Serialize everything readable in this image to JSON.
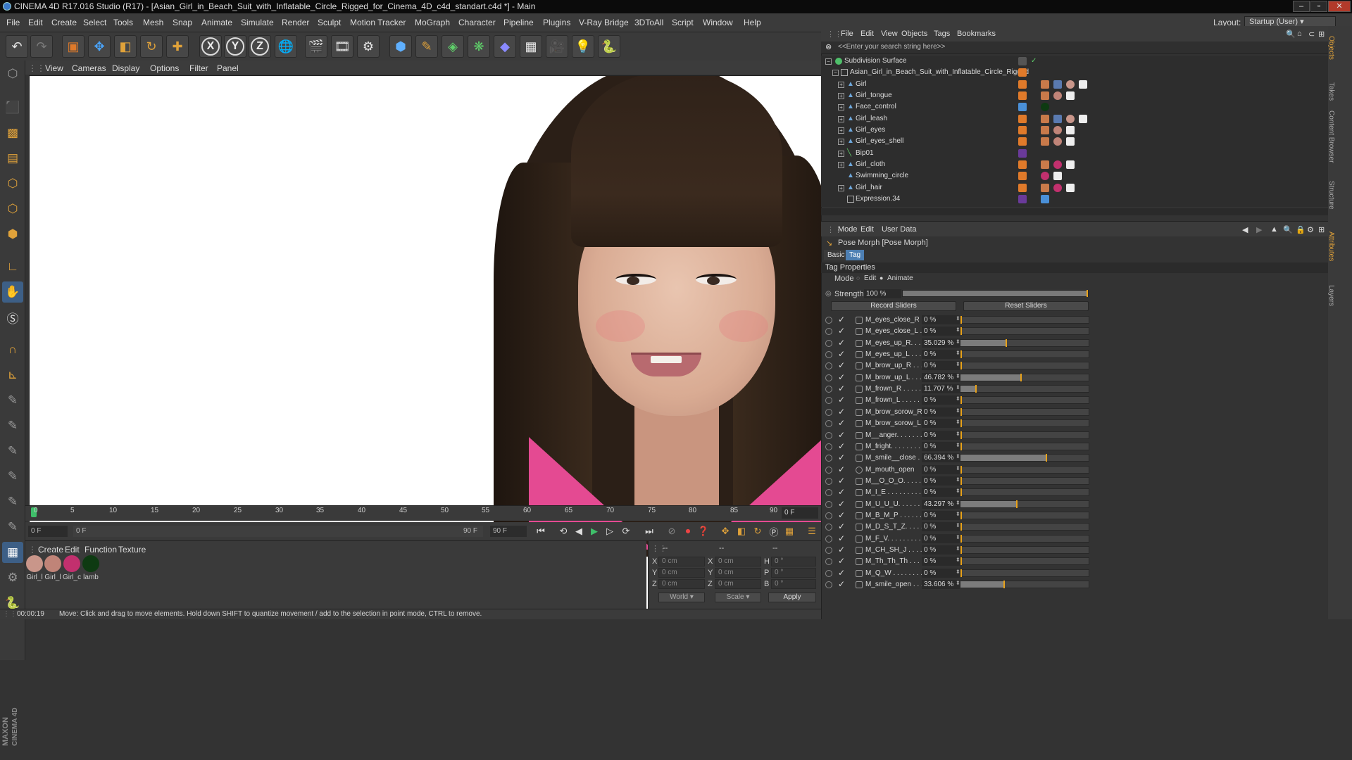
{
  "window": {
    "title": "CINEMA 4D R17.016 Studio (R17) - [Asian_Girl_in_Beach_Suit_with_Inflatable_Circle_Rigged_for_Cinema_4D_c4d_standart.c4d *] - Main"
  },
  "menubar": {
    "items": [
      "File",
      "Edit",
      "Create",
      "Select",
      "Tools",
      "Mesh",
      "Snap",
      "Animate",
      "Simulate",
      "Render",
      "Sculpt",
      "Motion Tracker",
      "MoGraph",
      "Character",
      "Pipeline",
      "Plugins",
      "V-Ray Bridge",
      "3DToAll",
      "Script",
      "Window",
      "Help"
    ],
    "layout_label": "Layout:",
    "layout_value": "Startup (User)"
  },
  "toolbar": {
    "axis_x": "X",
    "axis_y": "Y",
    "axis_z": "Z"
  },
  "viewport": {
    "menu": [
      "View",
      "Cameras",
      "Display",
      "Options",
      "Filter",
      "Panel"
    ]
  },
  "timeline": {
    "ticks": [
      "0",
      "5",
      "10",
      "15",
      "20",
      "25",
      "30",
      "35",
      "40",
      "45",
      "50",
      "55",
      "60",
      "65",
      "70",
      "75",
      "80",
      "85",
      "90"
    ],
    "current_frame": "0 F",
    "start_field": "0 F",
    "range_start": "0 F",
    "range_end": "90 F",
    "end_field": "90 F"
  },
  "materials": {
    "menu": [
      "Create",
      "Edit",
      "Function",
      "Texture"
    ],
    "items": [
      {
        "label": "Girl_l",
        "color": "#c9968a"
      },
      {
        "label": "Girl_l",
        "color": "#c08478"
      },
      {
        "label": "Girl_c",
        "color": "#c2306e"
      },
      {
        "label": "lamb",
        "color": "#0e3a12"
      }
    ]
  },
  "coords": {
    "header": [
      "--",
      "--",
      "--"
    ],
    "rows": [
      {
        "a": "X",
        "av": "0 cm",
        "b": "X",
        "bv": "0 cm",
        "c": "H",
        "cv": "0 °"
      },
      {
        "a": "Y",
        "av": "0 cm",
        "b": "Y",
        "bv": "0 cm",
        "c": "P",
        "cv": "0 °"
      },
      {
        "a": "Z",
        "av": "0 cm",
        "b": "Z",
        "bv": "0 cm",
        "c": "B",
        "cv": "0 °"
      }
    ],
    "space": "World",
    "mode": "Scale",
    "apply": "Apply"
  },
  "status": {
    "time": "00:00:19",
    "message": "Move: Click and drag to move elements. Hold down SHIFT to quantize movement / add to the selection in point mode, CTRL to remove."
  },
  "objects_panel": {
    "menu": [
      "File",
      "Edit",
      "View",
      "Objects",
      "Tags",
      "Bookmarks"
    ],
    "search_placeholder": "<<Enter your search string here>>",
    "tree": [
      {
        "name": "Subdivision Surface",
        "level": 0,
        "layer": ""
      },
      {
        "name": "Asian_Girl_in_Beach_Suit_with_Inflatable_Circle_Rigged",
        "level": 1,
        "layer": "#e07a2a"
      },
      {
        "name": "Girl",
        "level": 2,
        "layer": "#e07a2a"
      },
      {
        "name": "Girl_tongue",
        "level": 2,
        "layer": "#e07a2a"
      },
      {
        "name": "Face_control",
        "level": 2,
        "layer": "#4a90d8"
      },
      {
        "name": "Girl_leash",
        "level": 2,
        "layer": "#e07a2a"
      },
      {
        "name": "Girl_eyes",
        "level": 2,
        "layer": "#e07a2a"
      },
      {
        "name": "Girl_eyes_shell",
        "level": 2,
        "layer": "#e07a2a"
      },
      {
        "name": "Bip01",
        "level": 2,
        "layer": "#6a3a9a"
      },
      {
        "name": "Girl_cloth",
        "level": 2,
        "layer": "#e07a2a"
      },
      {
        "name": "Swimming_circle",
        "level": 2,
        "layer": "#e07a2a"
      },
      {
        "name": "Girl_hair",
        "level": 2,
        "layer": "#e07a2a"
      },
      {
        "name": "Expression.34",
        "level": 2,
        "layer": "#6a3a9a"
      }
    ]
  },
  "side_tabs": [
    "Objects",
    "Takes",
    "Content Browser",
    "Structure",
    "Attributes",
    "Layers"
  ],
  "attributes": {
    "menu": [
      "Mode",
      "Edit",
      "User Data"
    ],
    "title": "Pose Morph [Pose Morph]",
    "tabs": [
      "Basic",
      "Tag"
    ],
    "section": "Tag Properties",
    "mode_label": "Mode",
    "mode_options": [
      "Edit",
      "Animate"
    ],
    "strength_label": "Strength",
    "strength_value": "100 %",
    "strength": 1.0,
    "record_button": "Record Sliders",
    "reset_button": "Reset Sliders",
    "morphs": [
      {
        "name": "M_eyes_close_R . .",
        "value": "0 %",
        "pct": 0
      },
      {
        "name": "M_eyes_close_L . .",
        "value": "0 %",
        "pct": 0
      },
      {
        "name": "M_eyes_up_R. . . .",
        "value": "35.029 %",
        "pct": 35.029
      },
      {
        "name": "M_eyes_up_L . . . .",
        "value": "0 %",
        "pct": 0
      },
      {
        "name": "M_brow_up_R . . .",
        "value": "0 %",
        "pct": 0
      },
      {
        "name": "M_brow_up_L . . .",
        "value": "46.782 %",
        "pct": 46.782
      },
      {
        "name": "M_frown_R . . . . .",
        "value": "11.707 %",
        "pct": 11.707
      },
      {
        "name": "M_frown_L . . . . .",
        "value": "0 %",
        "pct": 0
      },
      {
        "name": "M_brow_sorow_R",
        "value": "0 %",
        "pct": 0
      },
      {
        "name": "M_brow_sorow_L",
        "value": "0 %",
        "pct": 0
      },
      {
        "name": "M__anger. . . . . . .",
        "value": "0 %",
        "pct": 0
      },
      {
        "name": "M_fright. . . . . . . .",
        "value": "0 %",
        "pct": 0
      },
      {
        "name": "M_smile__close . .",
        "value": "66.394 %",
        "pct": 66.394
      },
      {
        "name": "M_mouth_open",
        "value": "0 %",
        "pct": 0
      },
      {
        "name": "M__O_O_O. . . . . .",
        "value": "0 %",
        "pct": 0
      },
      {
        "name": "M_I_E . . . . . . . . .",
        "value": "0 %",
        "pct": 0
      },
      {
        "name": "M_U_U_U. . . . . . .",
        "value": "43.297 %",
        "pct": 43.297
      },
      {
        "name": "M_B_M_P . . . . . .",
        "value": "0 %",
        "pct": 0
      },
      {
        "name": "M_D_S_T_Z. . . . .",
        "value": "0 %",
        "pct": 0
      },
      {
        "name": "M_F_V. . . . . . . . .",
        "value": "0 %",
        "pct": 0
      },
      {
        "name": "M_CH_SH_J . . . .",
        "value": "0 %",
        "pct": 0
      },
      {
        "name": "M_Th_Th_Th . . . .",
        "value": "0 %",
        "pct": 0
      },
      {
        "name": "M_Q_W . . . . . . . .",
        "value": "0 %",
        "pct": 0
      },
      {
        "name": "M_smile_open . . .",
        "value": "33.606 %",
        "pct": 33.606
      }
    ]
  }
}
